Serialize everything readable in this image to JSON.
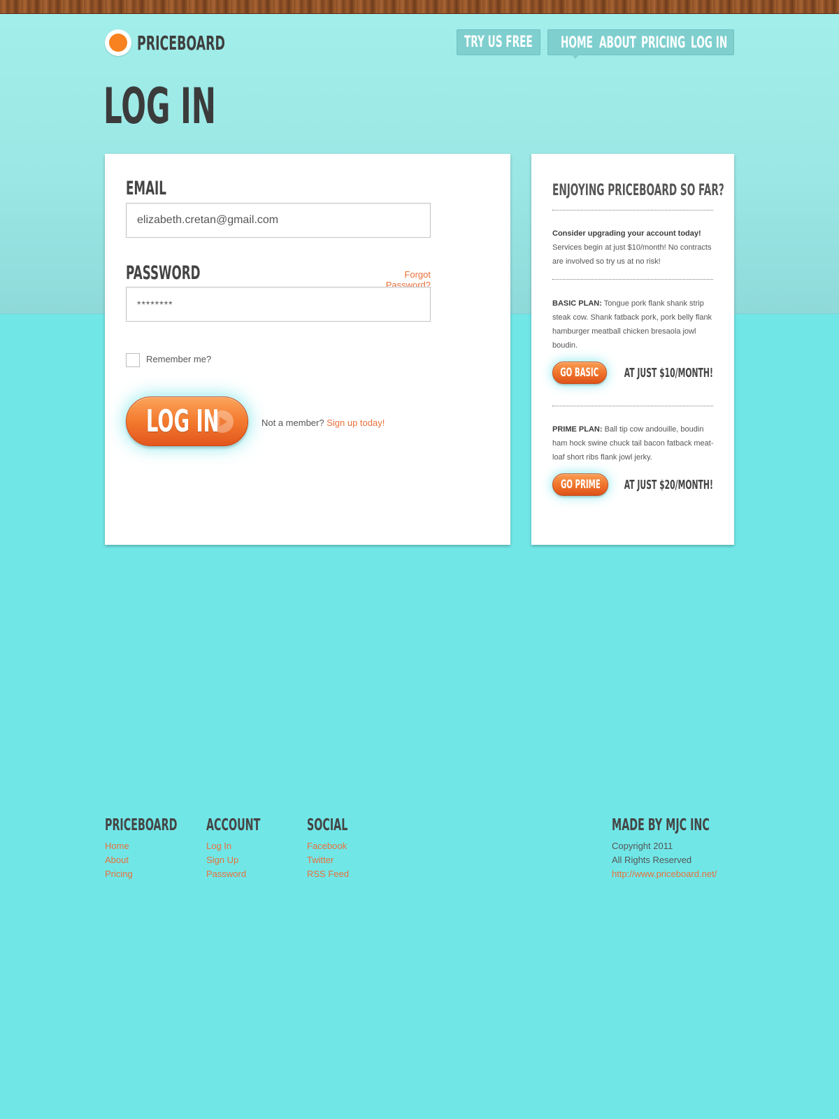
{
  "header": {
    "logo_text": "PRICEBOARD",
    "try_label": "TRY US FREE",
    "nav": [
      "HOME",
      "ABOUT",
      "PRICING",
      "LOG IN"
    ]
  },
  "page_title": "LOG IN",
  "login": {
    "email_label": "EMAIL",
    "email_value": "elizabeth.cretan@gmail.com",
    "password_label": "PASSWORD",
    "password_value": "********",
    "forgot_label": "Forgot Password?",
    "remember_label": "Remember me?",
    "button_label": "LOG IN",
    "not_member": "Not a member?",
    "signup_link": "Sign up today!"
  },
  "sidebar": {
    "title": "ENJOYING PRICEBOARD SO FAR?",
    "upgrade_bold": "Consider upgrading your account today!",
    "upgrade_text": "Services begin at just $10/month! No contracts are involved so try us at no risk!",
    "basic_bold": "BASIC PLAN:",
    "basic_text": "Tongue pork flank shank strip steak cow. Shank fatback pork, pork belly flank hamburger meatball chicken bresaola jowl boudin.",
    "basic_button": "GO BASIC",
    "basic_price": "AT JUST $10/MONTH!",
    "prime_bold": "PRIME PLAN:",
    "prime_text": "Ball tip cow andouille, boudin ham hock swine chuck tail bacon fatback meat-loaf short ribs flank jowl jerky.",
    "prime_button": "GO PRIME",
    "prime_price": "AT JUST $20/MONTH!"
  },
  "footer": {
    "col1": {
      "heading": "PRICEBOARD",
      "links": [
        "Home",
        "About",
        "Pricing"
      ]
    },
    "col2": {
      "heading": "ACCOUNT",
      "links": [
        "Log In",
        "Sign Up",
        "Password"
      ]
    },
    "col3": {
      "heading": "SOCIAL",
      "links": [
        "Facebook",
        "Twitter",
        "RSS Feed"
      ]
    },
    "col4": {
      "heading": "MADE BY MJC INC",
      "lines": [
        "Copyright 2011",
        "All Rights Reserved"
      ],
      "url": "http://www.priceboard.net/"
    }
  },
  "colors": {
    "background": "#71e6e7",
    "accent_orange": "#f37a2e",
    "link_orange": "#e8703a",
    "nav_teal": "#7fcfcf",
    "heading_dark": "#3b3b3b"
  }
}
